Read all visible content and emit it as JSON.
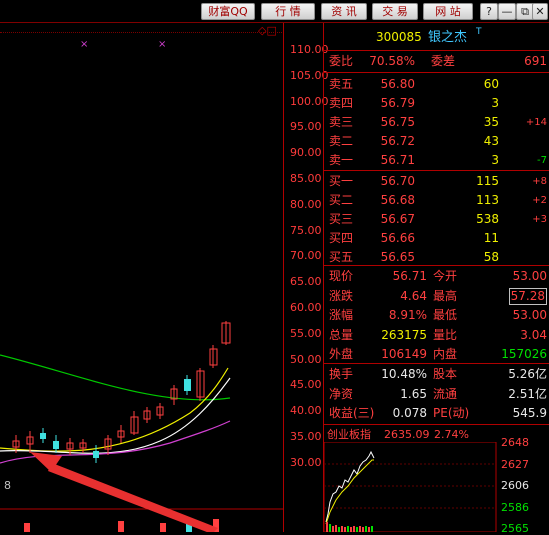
{
  "toolbar": {
    "buttons": [
      "财富QQ",
      "行 情",
      "资 讯",
      "交 易",
      "网 站"
    ],
    "window_buttons": [
      "?",
      "—",
      "⧉",
      "✕"
    ]
  },
  "chart": {
    "header_icons": "◇□",
    "y_labels": [
      "110.00",
      "105.00",
      "100.00",
      "95.00",
      "90.00",
      "85.00",
      "80.00",
      "75.00",
      "70.00",
      "65.00",
      "60.00",
      "55.00",
      "50.00",
      "45.00",
      "40.00",
      "35.00",
      "30.00"
    ],
    "bottom_left_label": "8"
  },
  "quote": {
    "code": "300085",
    "name": "银之杰",
    "flag": "T",
    "webi_label": "委比",
    "webi": "70.58%",
    "weicha_label": "委差",
    "weicha": "691",
    "asks": [
      {
        "label": "卖五",
        "price": "56.80",
        "vol": "60",
        "chg": ""
      },
      {
        "label": "卖四",
        "price": "56.79",
        "vol": "3",
        "chg": ""
      },
      {
        "label": "卖三",
        "price": "56.75",
        "vol": "35",
        "chg": "+14"
      },
      {
        "label": "卖二",
        "price": "56.72",
        "vol": "43",
        "chg": ""
      },
      {
        "label": "卖一",
        "price": "56.71",
        "vol": "3",
        "chg": "-7"
      }
    ],
    "bids": [
      {
        "label": "买一",
        "price": "56.70",
        "vol": "115",
        "chg": "+8"
      },
      {
        "label": "买二",
        "price": "56.68",
        "vol": "113",
        "chg": "+2"
      },
      {
        "label": "买三",
        "price": "56.67",
        "vol": "538",
        "chg": "+3"
      },
      {
        "label": "买四",
        "price": "56.66",
        "vol": "11",
        "chg": ""
      },
      {
        "label": "买五",
        "price": "56.65",
        "vol": "58",
        "chg": ""
      }
    ],
    "stats1": [
      {
        "l1": "现价",
        "v1": "56.71",
        "l2": "今开",
        "v2": "53.00"
      },
      {
        "l1": "涨跌",
        "v1": "4.64",
        "l2": "最高",
        "v2": "57.28"
      },
      {
        "l1": "涨幅",
        "v1": "8.91%",
        "l2": "最低",
        "v2": "53.00"
      },
      {
        "l1": "总量",
        "v1": "263175",
        "l2": "量比",
        "v2": "3.04"
      },
      {
        "l1": "外盘",
        "v1": "106149",
        "l2": "内盘",
        "v2": "157026"
      }
    ],
    "stats2": [
      {
        "l1": "换手",
        "v1": "10.48%",
        "l2": "股本",
        "v2": "5.26亿"
      },
      {
        "l1": "净资",
        "v1": "1.65",
        "l2": "流通",
        "v2": "2.51亿"
      },
      {
        "l1": "收益(三)",
        "v1": "0.078",
        "l2": "PE(动)",
        "v2": "545.9"
      }
    ]
  },
  "index": {
    "name": "创业板指",
    "value": "2635.09",
    "pct": "2.74%",
    "y_labels": [
      "2648",
      "2627",
      "2606",
      "2586",
      "2565"
    ]
  },
  "colors": {
    "up": "#ff4040",
    "down": "#00e000",
    "accent": "#f0f000",
    "border": "#b00000"
  }
}
